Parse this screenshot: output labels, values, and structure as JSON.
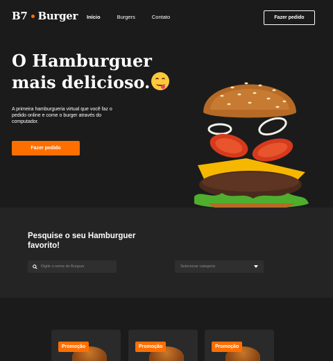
{
  "header": {
    "logo_left": "B7",
    "logo_right": "Burger",
    "nav": [
      "Início",
      "Burgers",
      "Contato"
    ],
    "order_button": "Fazer pedido"
  },
  "hero": {
    "title": "O Hamburguer mais delicioso.",
    "description": "A primeira hamburgueria virtual que você faz o pedido online e come o burger através do computador.",
    "cta": "Fazer pedido"
  },
  "search": {
    "title": "Pesquise o seu Hamburguer favorito!",
    "placeholder": "Digite o nome do Burguer",
    "category_placeholder": "Selecionar categoria"
  },
  "products": {
    "badges": [
      "Promoção",
      "Promoção",
      "Promoção"
    ]
  },
  "colors": {
    "accent": "#ff6f00",
    "background": "#1b1b1b",
    "section": "#242424"
  }
}
